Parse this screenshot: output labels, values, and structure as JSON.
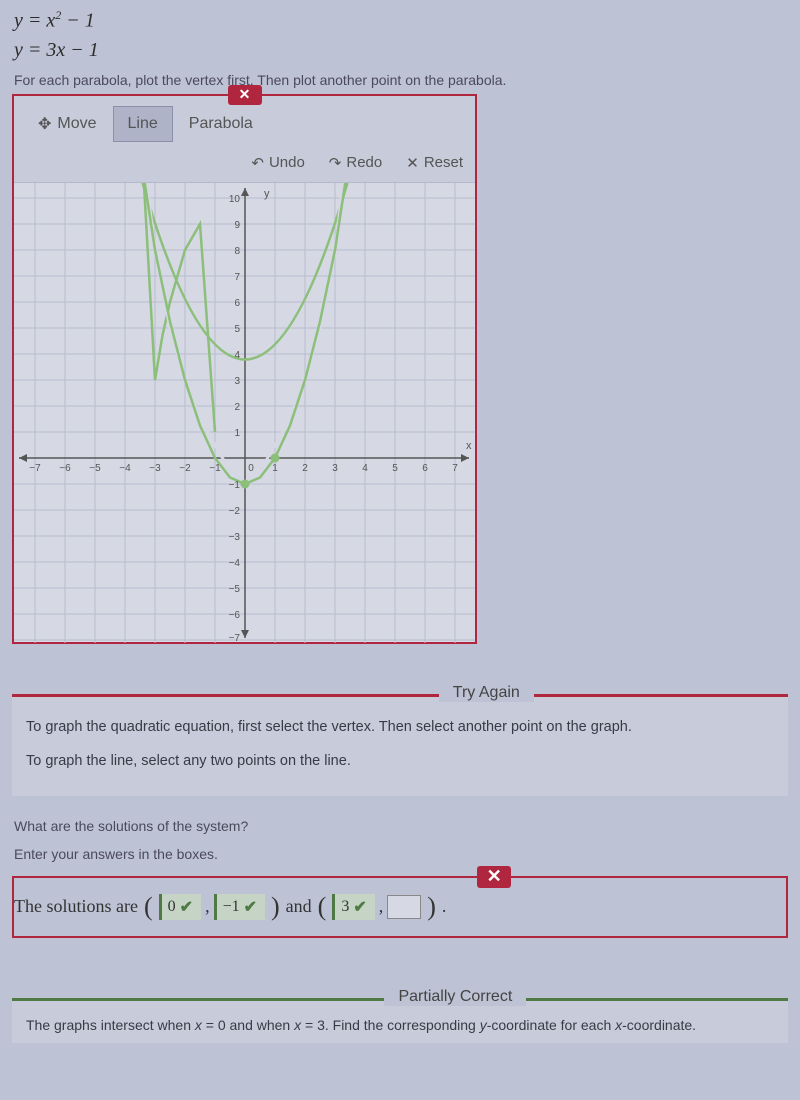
{
  "equations": {
    "eq1_lhs": "y",
    "eq1_rhs_base": "x",
    "eq1_rhs_exp": "2",
    "eq1_rhs_tail": " − 1",
    "eq2": "y = 3x − 1"
  },
  "instruction": "For each parabola, plot the vertex first. Then plot another point on the parabola.",
  "toolbar": {
    "move": "Move",
    "line": "Line",
    "parabola": "Parabola",
    "undo": "Undo",
    "redo": "Redo",
    "reset": "Reset"
  },
  "chart_data": {
    "type": "line",
    "x_axis": {
      "min": -7,
      "max": 7,
      "ticks": [
        -7,
        -6,
        -5,
        -4,
        -3,
        -2,
        -1,
        0,
        1,
        2,
        3,
        4,
        5,
        6,
        7
      ],
      "label": "x"
    },
    "y_axis": {
      "min": -7,
      "max": 10,
      "ticks": [
        -7,
        -6,
        -5,
        -4,
        -3,
        -2,
        -1,
        1,
        2,
        3,
        4,
        5,
        6,
        7,
        8,
        9,
        10
      ],
      "label": "y"
    },
    "series": [
      {
        "name": "parabola",
        "color": "#8bbf7a",
        "equation": "y = x^2 - 1",
        "points_plotted": [
          [
            0,
            -1
          ],
          [
            1,
            0
          ]
        ]
      }
    ]
  },
  "try_again": {
    "title": "Try Again",
    "line1": "To graph the quadratic equation, first select the vertex. Then select another point on the graph.",
    "line2": "To graph the line, select any two points on the line."
  },
  "question": {
    "q1": "What are the solutions of the system?",
    "q2": "Enter your answers in the boxes."
  },
  "answers": {
    "lead": "The solutions are ",
    "val1": "0",
    "val2": "−1",
    "mid": " and ",
    "val3": "3",
    "val4": "",
    "tail": "."
  },
  "partially": {
    "title": "Partially Correct",
    "text_a": "The graphs intersect when ",
    "text_b": " = 0 and when ",
    "text_c": " = 3. Find the corresponding ",
    "text_d": "-coordinate for each ",
    "text_e": "-coordinate.",
    "x": "x",
    "y": "y"
  }
}
